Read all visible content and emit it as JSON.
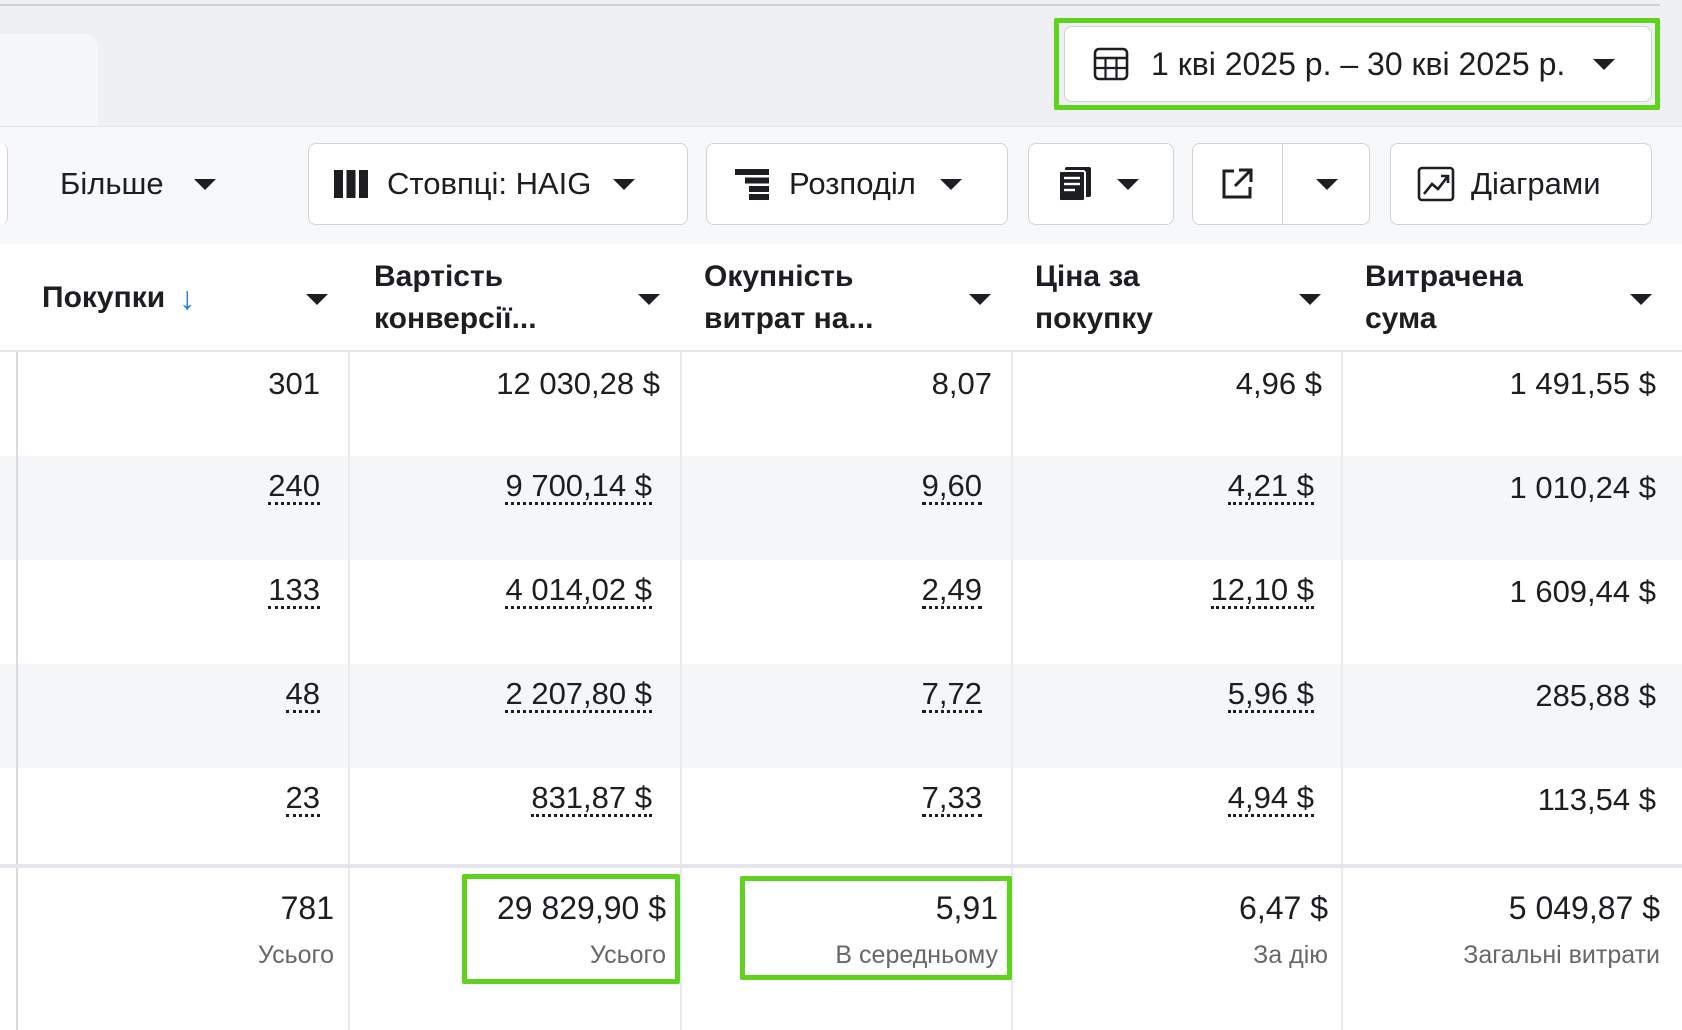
{
  "date_range": {
    "label": "1 кві 2025 р. – 30 кві 2025 р.",
    "icon": "calendar-grid-icon"
  },
  "toolbar": {
    "more_label": "Більше",
    "columns_label": "Стовпці: HAIG",
    "breakdown_label": "Розподіл",
    "reports_icon": "reports-icon",
    "export_icon": "export-icon",
    "charts_label": "Діаграми"
  },
  "table": {
    "columns": [
      {
        "key": "purchases",
        "label": "Покупки",
        "sort": "desc"
      },
      {
        "key": "conv_value",
        "label": "Вартість конверсії..."
      },
      {
        "key": "roas",
        "label": "Окупність витрат на..."
      },
      {
        "key": "cpp",
        "label": "Ціна за покупку"
      },
      {
        "key": "spent",
        "label": "Витрачена сума"
      }
    ],
    "rows": [
      {
        "purchases": "301",
        "conv_value": "12 030,28 $",
        "roas": "8,07",
        "cpp": "4,96 $",
        "spent": "1 491,55 $"
      },
      {
        "purchases": "240",
        "conv_value": "9 700,14 $",
        "roas": "9,60",
        "cpp": "4,21 $",
        "spent": "1 010,24 $"
      },
      {
        "purchases": "133",
        "conv_value": "4 014,02 $",
        "roas": "2,49",
        "cpp": "12,10 $",
        "spent": "1 609,44 $"
      },
      {
        "purchases": "48",
        "conv_value": "2 207,80 $",
        "roas": "7,72",
        "cpp": "5,96 $",
        "spent": "285,88 $"
      },
      {
        "purchases": "23",
        "conv_value": "831,87 $",
        "roas": "7,33",
        "cpp": "4,94 $",
        "spent": "113,54 $"
      }
    ],
    "totals": {
      "purchases": {
        "value": "781",
        "caption": "Усього"
      },
      "conv_value": {
        "value": "29 829,90 $",
        "caption": "Усього"
      },
      "roas": {
        "value": "5,91",
        "caption": "В середньому"
      },
      "cpp": {
        "value": "6,47 $",
        "caption": "За дію"
      },
      "spent": {
        "value": "5 049,87 $",
        "caption": "Загальні витрати"
      }
    }
  },
  "colors": {
    "highlight": "#5fd11f",
    "sort_arrow": "#1877f2"
  }
}
